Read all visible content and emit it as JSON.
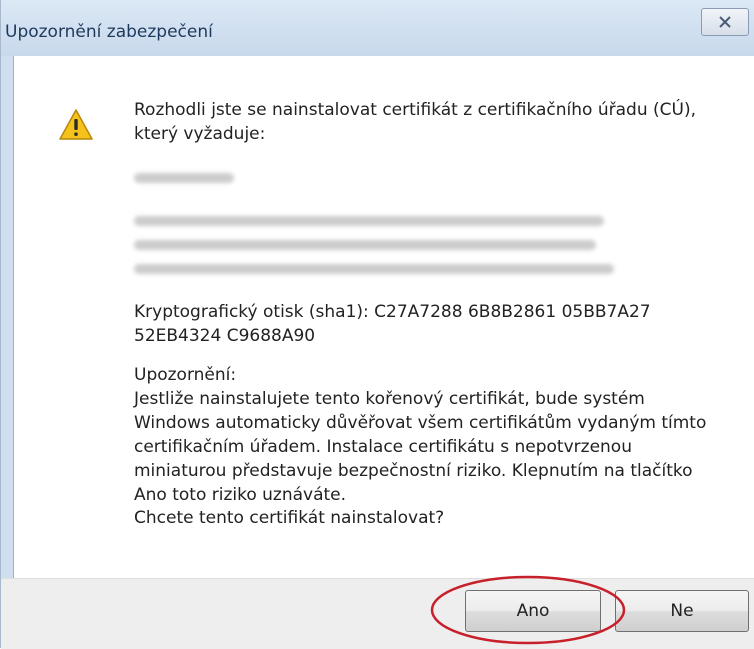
{
  "dialog": {
    "title": "Upozornění zabezpečení",
    "close_symbol": "x"
  },
  "message": {
    "intro": "Rozhodli jste se nainstalovat certifikát z certifikačního úřadu (CÚ), který vyžaduje:",
    "thumbprint": "Kryptografický otisk (sha1): C27A7288 6B8B2861 05BB7A27 52EB4324 C9688A90",
    "warning_heading": "Upozornění:",
    "warning_body": "Jestliže nainstalujete tento kořenový certifikát, bude systém Windows automaticky důvěřovat všem certifikátům vydaným tímto certifikačním úřadem. Instalace certifikátu s nepotvrzenou miniaturou představuje bezpečnostní riziko. Klepnutím na tlačítko Ano toto riziko uznáváte.",
    "question": "Chcete tento certifikát nainstalovat?"
  },
  "buttons": {
    "yes": "Ano",
    "no": "Ne"
  },
  "icons": {
    "warning": "warning-triangle-icon",
    "close": "close-icon"
  },
  "colors": {
    "annotation_circle": "#c8202a",
    "warning_yellow": "#f4c21a",
    "title_text": "#1e395b"
  }
}
